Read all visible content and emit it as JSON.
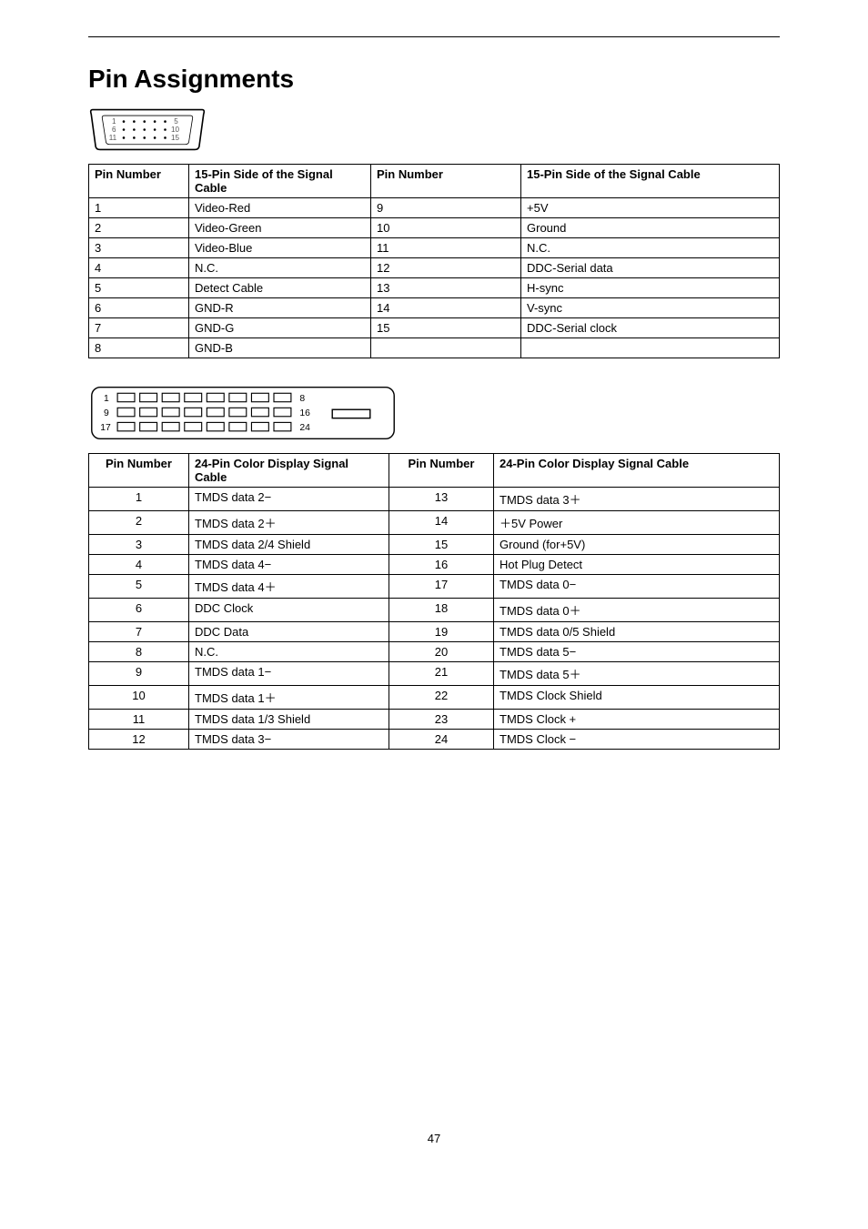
{
  "title": "Pin Assignments",
  "page_number": "47",
  "connector15": {
    "labels": [
      "1",
      "5",
      "6",
      "10",
      "11",
      "15"
    ]
  },
  "table15": {
    "headers": {
      "pin1": "Pin Number",
      "sig1": "15-Pin Side of the Signal Cable",
      "pin2": "Pin Number",
      "sig2": "15-Pin Side of the Signal Cable"
    },
    "rows": [
      {
        "p1": "1",
        "s1": "Video-Red",
        "p2": "9",
        "s2": "+5V"
      },
      {
        "p1": "2",
        "s1": "Video-Green",
        "p2": "10",
        "s2": "Ground"
      },
      {
        "p1": "3",
        "s1": "Video-Blue",
        "p2": "11",
        "s2": "N.C."
      },
      {
        "p1": "4",
        "s1": "N.C.",
        "p2": "12",
        "s2": "DDC-Serial data"
      },
      {
        "p1": "5",
        "s1": "Detect Cable",
        "p2": "13",
        "s2": "H-sync"
      },
      {
        "p1": "6",
        "s1": "GND-R",
        "p2": "14",
        "s2": "V-sync"
      },
      {
        "p1": "7",
        "s1": "GND-G",
        "p2": "15",
        "s2": "DDC-Serial clock"
      },
      {
        "p1": "8",
        "s1": "GND-B",
        "p2": "",
        "s2": ""
      }
    ]
  },
  "connector24": {
    "labels": [
      "1",
      "8",
      "9",
      "16",
      "17",
      "24"
    ]
  },
  "table24": {
    "headers": {
      "pin1": "Pin Number",
      "sig1": "24-Pin Color Display Signal Cable",
      "pin2": "Pin Number",
      "sig2": "24-Pin Color Display Signal Cable"
    },
    "rows": [
      {
        "p1": "1",
        "s1": "TMDS data 2−",
        "p2": "13",
        "s2": "TMDS data 3＋"
      },
      {
        "p1": "2",
        "s1": "TMDS data 2＋",
        "p2": "14",
        "s2": "＋5V Power"
      },
      {
        "p1": "3",
        "s1": "TMDS data 2/4 Shield",
        "p2": "15",
        "s2": "Ground (for+5V)"
      },
      {
        "p1": "4",
        "s1": "TMDS data 4−",
        "p2": "16",
        "s2": "Hot Plug Detect"
      },
      {
        "p1": "5",
        "s1": "TMDS data 4＋",
        "p2": "17",
        "s2": "TMDS data 0−"
      },
      {
        "p1": "6",
        "s1": "DDC Clock",
        "p2": "18",
        "s2": "TMDS data 0＋"
      },
      {
        "p1": "7",
        "s1": "DDC Data",
        "p2": "19",
        "s2": "TMDS data 0/5 Shield"
      },
      {
        "p1": "8",
        "s1": "N.C.",
        "p2": "20",
        "s2": "TMDS data 5−"
      },
      {
        "p1": "9",
        "s1": "TMDS data 1−",
        "p2": "21",
        "s2": "TMDS data 5＋"
      },
      {
        "p1": "10",
        "s1": "TMDS data 1＋",
        "p2": "22",
        "s2": "TMDS Clock Shield"
      },
      {
        "p1": "11",
        "s1": "TMDS data 1/3 Shield",
        "p2": "23",
        "s2": "TMDS Clock +"
      },
      {
        "p1": "12",
        "s1": "TMDS data 3−",
        "p2": "24",
        "s2": "TMDS Clock −"
      }
    ]
  }
}
